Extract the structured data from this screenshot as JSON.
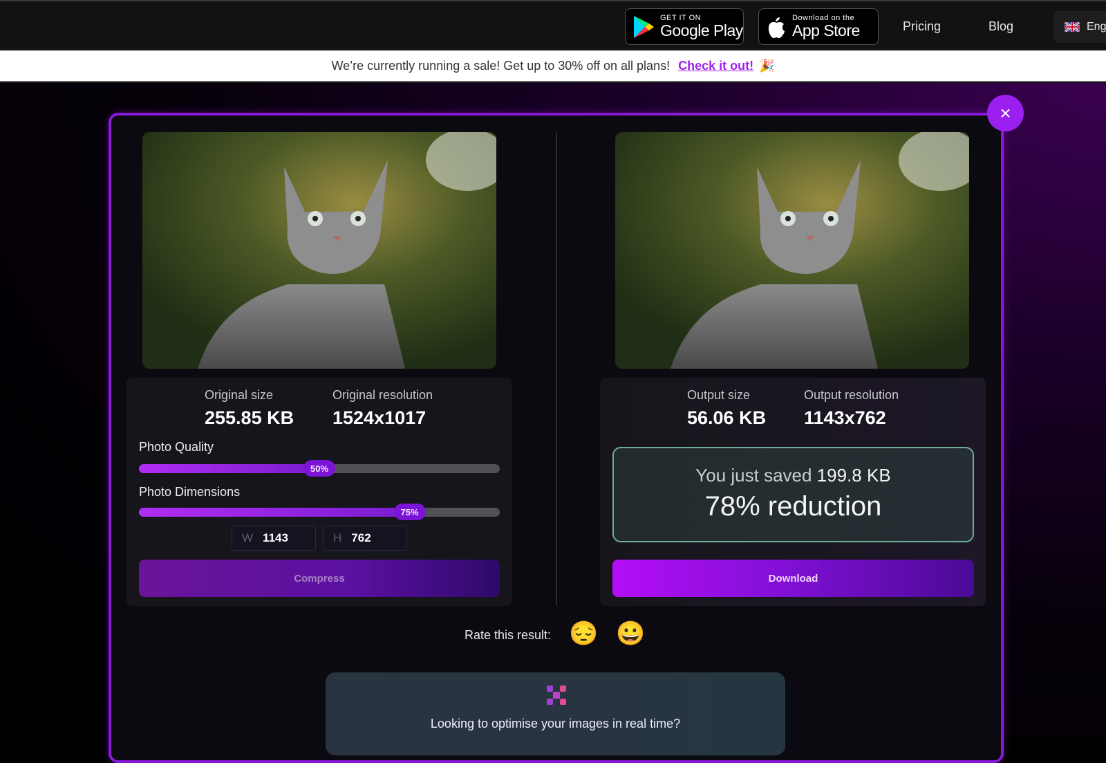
{
  "nav": {
    "google_play": {
      "small": "GET IT ON",
      "big": "Google Play"
    },
    "app_store": {
      "small": "Download on the",
      "big": "App Store"
    },
    "links": [
      "Pricing",
      "Blog"
    ],
    "language": "Eng"
  },
  "banner": {
    "message": "We’re currently running a sale! Get up to 30% off on all plans!",
    "link": "Check it out!",
    "emoji": "🎉"
  },
  "modal": {
    "close_icon": "×",
    "original": {
      "size_label": "Original size",
      "size_value": "255.85 KB",
      "resolution_label": "Original resolution",
      "resolution_value": "1524x1017",
      "quality_label": "Photo Quality",
      "quality_percent": 50,
      "quality_text": "50%",
      "dimensions_label": "Photo Dimensions",
      "dimensions_percent": 75,
      "dimensions_text": "75%",
      "width_prefix": "W",
      "width_value": "1143",
      "height_prefix": "H",
      "height_value": "762",
      "compress_label": "Compress"
    },
    "output": {
      "size_label": "Output size",
      "size_value": "56.06 KB",
      "resolution_label": "Output resolution",
      "resolution_value": "1143x762",
      "saved_prefix": "You just saved",
      "saved_amount": "199.8 KB",
      "reduction": "78% reduction",
      "download_label": "Download"
    },
    "rating": {
      "label": "Rate this result:",
      "sad_emoji": "😔",
      "happy_emoji": "😀"
    },
    "promo": {
      "text": "Looking to optimise your images in real time?"
    }
  },
  "colors": {
    "accent": "#9b1fee",
    "modal_border": "#8a18d8",
    "saved_border": "#6fae96",
    "link": "#a020f0"
  }
}
